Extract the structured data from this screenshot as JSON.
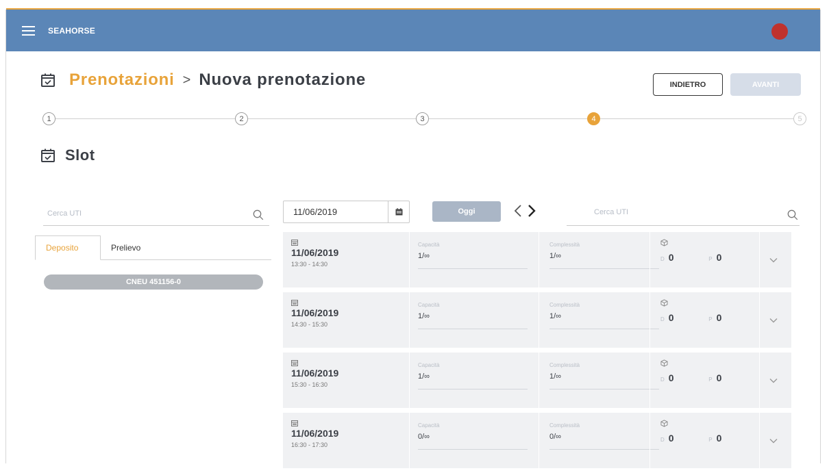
{
  "app": {
    "brand": "SEAHORSE"
  },
  "breadcrumb": {
    "parent": "Prenotazioni",
    "separator": ">",
    "current": "Nuova prenotazione"
  },
  "actions": {
    "back_label": "INDIETRO",
    "next_label": "AVANTI"
  },
  "stepper": {
    "steps": [
      "1",
      "2",
      "3",
      "4",
      "5"
    ],
    "active_step": 4
  },
  "section": {
    "title": "Slot"
  },
  "left_panel": {
    "search_placeholder": "Cerca UTI",
    "tabs": [
      {
        "label": "Deposito",
        "active": true
      },
      {
        "label": "Prelievo",
        "active": false
      }
    ],
    "chip_label": "CNEU 451156-0"
  },
  "toolbar": {
    "date_value": "11/06/2019",
    "today_label": "Oggi",
    "search_placeholder": "Cerca UTI"
  },
  "slots": [
    {
      "date": "11/06/2019",
      "time": "13:30 - 14:30",
      "capacity_label": "Capacità",
      "capacity": "1/∞",
      "complexity_label": "Complessità",
      "complexity": "1/∞",
      "d_label": "D",
      "d_value": "0",
      "p_label": "P",
      "p_value": "0"
    },
    {
      "date": "11/06/2019",
      "time": "14:30 - 15:30",
      "capacity_label": "Capacità",
      "capacity": "1/∞",
      "complexity_label": "Complessità",
      "complexity": "1/∞",
      "d_label": "D",
      "d_value": "0",
      "p_label": "P",
      "p_value": "0"
    },
    {
      "date": "11/06/2019",
      "time": "15:30 - 16:30",
      "capacity_label": "Capacità",
      "capacity": "1/∞",
      "complexity_label": "Complessità",
      "complexity": "1/∞",
      "d_label": "D",
      "d_value": "0",
      "p_label": "P",
      "p_value": "0"
    },
    {
      "date": "11/06/2019",
      "time": "16:30 - 17:30",
      "capacity_label": "Capacità",
      "capacity": "0/∞",
      "complexity_label": "Complessità",
      "complexity": "0/∞",
      "d_label": "D",
      "d_value": "0",
      "p_label": "P",
      "p_value": "0"
    }
  ],
  "colors": {
    "appbar": "#5b86b7",
    "accent": "#e8a33a",
    "avatar": "#c0322d",
    "slot_bg": "#f0f1f3"
  },
  "icons": {
    "menu": "hamburger-icon",
    "calendar": "calendar-check-icon",
    "search": "search-icon",
    "box": "box-icon",
    "chevron": "chevron-down-icon"
  }
}
